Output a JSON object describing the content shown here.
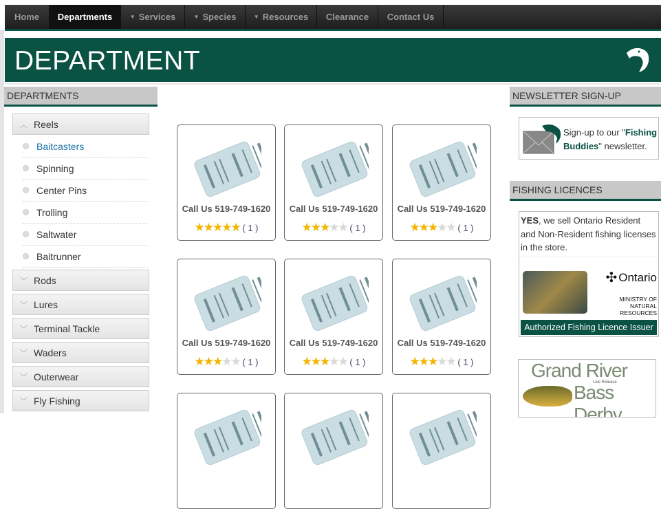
{
  "nav": [
    {
      "label": "Home",
      "dropdown": false
    },
    {
      "label": "Departments",
      "dropdown": false,
      "active": true
    },
    {
      "label": "Services",
      "dropdown": true
    },
    {
      "label": "Species",
      "dropdown": true
    },
    {
      "label": "Resources",
      "dropdown": true
    },
    {
      "label": "Clearance",
      "dropdown": false
    },
    {
      "label": "Contact Us",
      "dropdown": false
    }
  ],
  "banner": {
    "title": "DEPARTMENT"
  },
  "sidebar": {
    "title": "DEPARTMENTS",
    "expanded": {
      "label": "Reels",
      "items": [
        "Baitcasters",
        "Spinning",
        "Center Pins",
        "Trolling",
        "Saltwater",
        "Baitrunner"
      ],
      "selected": "Baitcasters"
    },
    "collapsed": [
      "Rods",
      "Lures",
      "Terminal Tackle",
      "Waders",
      "Outerwear",
      "Fly Fishing"
    ]
  },
  "products": [
    {
      "label": "Call Us 519-749-1620",
      "rating": 5,
      "count": "( 1 )"
    },
    {
      "label": "Call Us 519-749-1620",
      "rating": 3,
      "count": "( 1 )"
    },
    {
      "label": "Call Us 519-749-1620",
      "rating": 3,
      "count": "( 1 )"
    },
    {
      "label": "Call Us 519-749-1620",
      "rating": 3,
      "count": "( 1 )"
    },
    {
      "label": "Call Us 519-749-1620",
      "rating": 3,
      "count": "( 1 )"
    },
    {
      "label": "Call Us 519-749-1620",
      "rating": 3,
      "count": "( 1 )"
    }
  ],
  "newsletter": {
    "title": "NEWSLETTER SIGN-UP",
    "pre": "Sign-up to our \"",
    "bold": "Fishing Buddies",
    "post": "\" newsletter."
  },
  "licences": {
    "title": "FISHING LICENCES",
    "yes": "YES",
    "text": ", we sell Ontario Resident and Non-Resident fishing licenses in the store.",
    "ontario": "Ontario",
    "ministry1": "MINISTRY OF",
    "ministry2": "NATURAL RESOURCES",
    "issuer": "Authorized Fishing Licence Issuer"
  },
  "derby": {
    "line1": "Grand River",
    "line2": "Bass Derby",
    "small": "Live Release"
  },
  "colors": {
    "brand": "#0a5244",
    "link": "#1a73a8",
    "star": "#f2b600"
  }
}
